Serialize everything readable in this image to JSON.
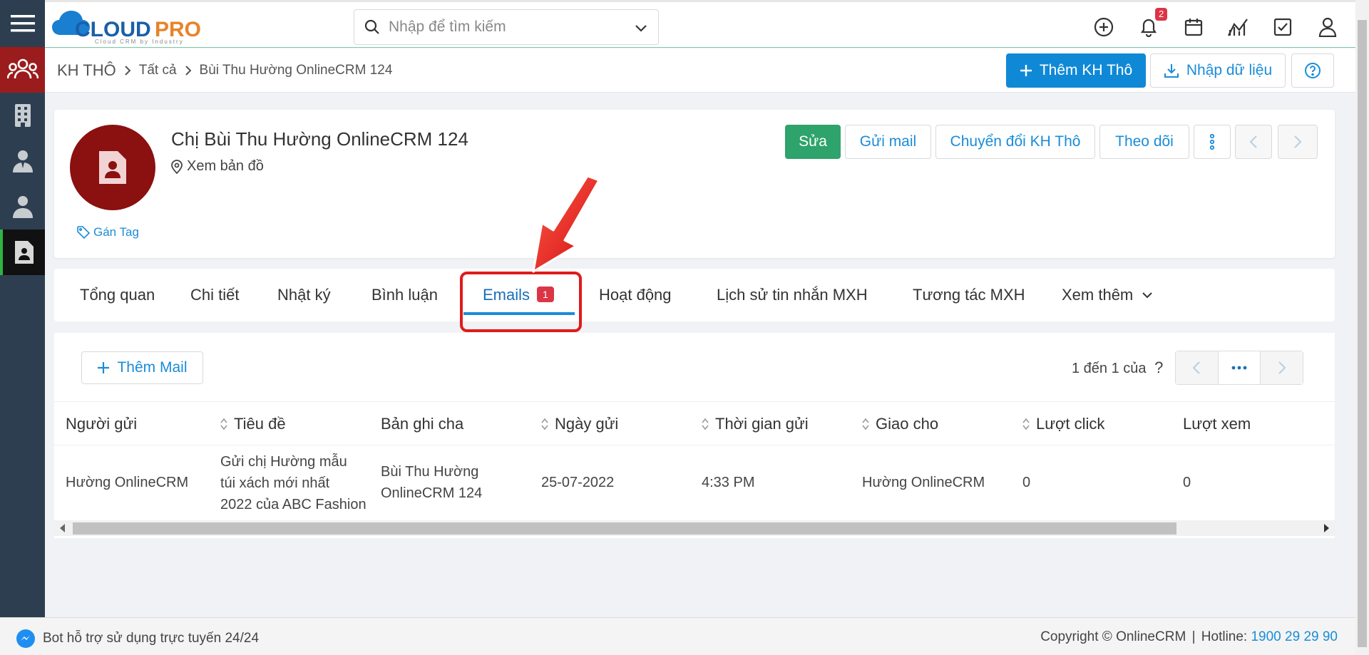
{
  "app": {
    "logo_text": "CLOUDPRO",
    "logo_tagline": "Cloud CRM by Industry"
  },
  "search": {
    "placeholder": "Nhập để tìm kiếm"
  },
  "topbar": {
    "notification_count": "2"
  },
  "breadcrumb": {
    "root": "KH THÔ",
    "level1": "Tất cả",
    "current": "Bùi Thu Hường OnlineCRM 124"
  },
  "header_actions": {
    "add_label": "Thêm KH Thô",
    "import_label": "Nhập dữ liệu"
  },
  "profile": {
    "name": "Chị Bùi Thu Hường OnlineCRM 124",
    "map_link": "Xem bản đồ",
    "tag_link": "Gán Tag",
    "actions": {
      "edit": "Sửa",
      "send_mail": "Gửi mail",
      "convert": "Chuyển đổi KH Thô",
      "follow": "Theo dõi"
    }
  },
  "tabs": [
    {
      "label": "Tổng quan"
    },
    {
      "label": "Chi tiết"
    },
    {
      "label": "Nhật ký"
    },
    {
      "label": "Bình luận"
    },
    {
      "label": "Emails",
      "badge": "1",
      "active": true
    },
    {
      "label": "Hoạt động"
    },
    {
      "label": "Lịch sử tin nhắn MXH"
    },
    {
      "label": "Tương tác MXH"
    },
    {
      "label": "Xem thêm"
    }
  ],
  "emails": {
    "add_label": "Thêm Mail",
    "pager_text": "1 đến 1 của",
    "pager_unknown": "?",
    "columns": [
      "Người gửi",
      "Tiêu đề",
      "Bản ghi cha",
      "Ngày gửi",
      "Thời gian gửi",
      "Giao cho",
      "Lượt click",
      "Lượt xem"
    ],
    "rows": [
      {
        "sender": "Hường OnlineCRM",
        "subject_lines": [
          "Gửi chị Hường mẫu",
          "túi xách mới nhất",
          "2022 của ABC Fashion"
        ],
        "parent_lines": [
          "Bùi Thu Hường",
          "OnlineCRM 124"
        ],
        "date": "25-07-2022",
        "time": "4:33 PM",
        "assignee": "Hường OnlineCRM",
        "clicks": "0",
        "views": "0"
      }
    ]
  },
  "footer": {
    "bot_text": "Bot hỗ trợ sử dụng trực tuyến 24/24",
    "copyright": "Copyright © OnlineCRM",
    "hotline_label": "Hotline:",
    "hotline": "1900 29 29 90"
  },
  "colors": {
    "sidebar": "#2d3e50",
    "brand_blue": "#0f89d6",
    "edit_green": "#2ea36b",
    "avatar_red": "#8b1010",
    "annotation_red": "#e01b1b",
    "badge_red": "#dc3545"
  }
}
